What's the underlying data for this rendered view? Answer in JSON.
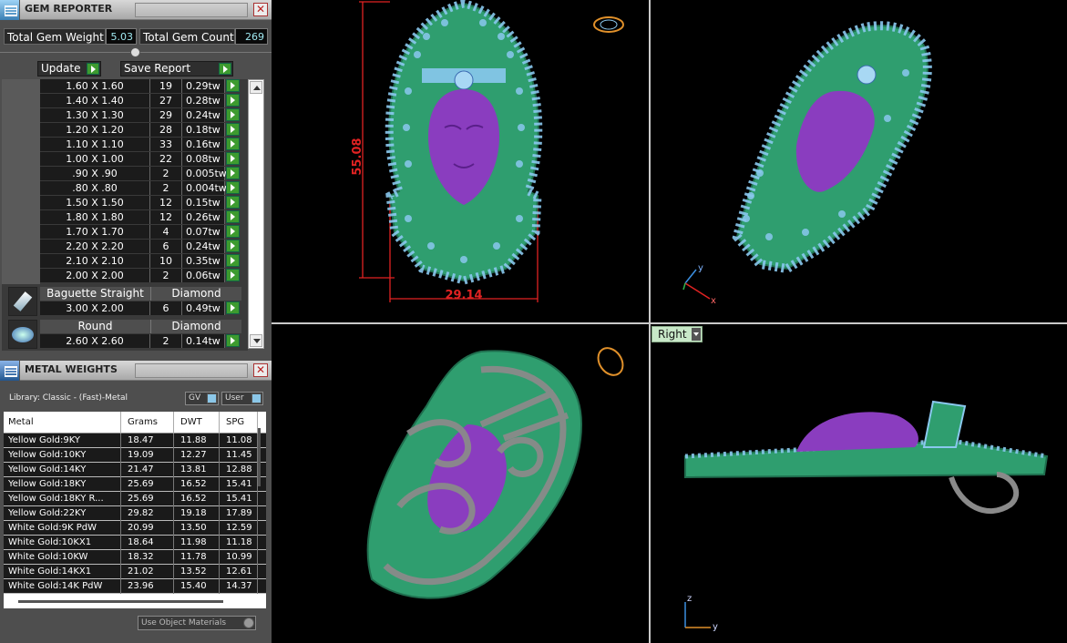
{
  "gem_reporter": {
    "title": "GEM REPORTER",
    "total_weight_label": "Total Gem Weight",
    "total_weight_value": "5.03",
    "total_count_label": "Total Gem Count",
    "total_count_value": "269",
    "update_label": "Update",
    "save_report_label": "Save Report",
    "rows": [
      {
        "size": "1.60 X 1.60",
        "count": "19",
        "tw": "0.29tw"
      },
      {
        "size": "1.40 X 1.40",
        "count": "27",
        "tw": "0.28tw"
      },
      {
        "size": "1.30 X 1.30",
        "count": "29",
        "tw": "0.24tw"
      },
      {
        "size": "1.20 X 1.20",
        "count": "28",
        "tw": "0.18tw"
      },
      {
        "size": "1.10 X 1.10",
        "count": "33",
        "tw": "0.16tw"
      },
      {
        "size": "1.00 X 1.00",
        "count": "22",
        "tw": "0.08tw"
      },
      {
        "size": ".90 X .90",
        "count": "2",
        "tw": "0.005tw"
      },
      {
        "size": ".80 X .80",
        "count": "2",
        "tw": "0.004tw"
      },
      {
        "size": "1.50 X 1.50",
        "count": "12",
        "tw": "0.15tw"
      },
      {
        "size": "1.80 X 1.80",
        "count": "12",
        "tw": "0.26tw"
      },
      {
        "size": "1.70 X 1.70",
        "count": "4",
        "tw": "0.07tw"
      },
      {
        "size": "2.20 X 2.20",
        "count": "6",
        "tw": "0.24tw"
      },
      {
        "size": "2.10 X 2.10",
        "count": "10",
        "tw": "0.35tw"
      },
      {
        "size": "2.00 X 2.00",
        "count": "2",
        "tw": "0.06tw"
      }
    ],
    "groups": [
      {
        "shape": "Baguette Straight",
        "material": "Diamond",
        "icon": "baguette-gem-icon",
        "row": {
          "size": "3.00 X 2.00",
          "count": "6",
          "tw": "0.49tw"
        }
      },
      {
        "shape": "Round",
        "material": "Diamond",
        "icon": "round-gem-icon",
        "row": {
          "size": "2.60 X 2.60",
          "count": "2",
          "tw": "0.14tw"
        }
      }
    ]
  },
  "metal_weights": {
    "title": "METAL WEIGHTS",
    "library": "Library: Classic - (Fast)-Metal",
    "gv_label": "GV",
    "user_label": "User",
    "columns": [
      "Metal",
      "Grams",
      "DWT",
      "SPG"
    ],
    "rows": [
      {
        "metal": "Yellow Gold:9KY",
        "grams": "18.47",
        "dwt": "11.88",
        "spg": "11.08"
      },
      {
        "metal": "Yellow Gold:10KY",
        "grams": "19.09",
        "dwt": "12.27",
        "spg": "11.45"
      },
      {
        "metal": "Yellow Gold:14KY",
        "grams": "21.47",
        "dwt": "13.81",
        "spg": "12.88"
      },
      {
        "metal": "Yellow Gold:18KY",
        "grams": "25.69",
        "dwt": "16.52",
        "spg": "15.41"
      },
      {
        "metal": "Yellow Gold:18KY R...",
        "grams": "25.69",
        "dwt": "16.52",
        "spg": "15.41"
      },
      {
        "metal": "Yellow Gold:22KY",
        "grams": "29.82",
        "dwt": "19.18",
        "spg": "17.89"
      },
      {
        "metal": "White Gold:9K PdW",
        "grams": "20.99",
        "dwt": "13.50",
        "spg": "12.59"
      },
      {
        "metal": "White Gold:10KX1",
        "grams": "18.64",
        "dwt": "11.98",
        "spg": "11.18"
      },
      {
        "metal": "White Gold:10KW",
        "grams": "18.32",
        "dwt": "11.78",
        "spg": "10.99"
      },
      {
        "metal": "White Gold:14KX1",
        "grams": "21.02",
        "dwt": "13.52",
        "spg": "12.61"
      },
      {
        "metal": "White Gold:14K PdW",
        "grams": "23.96",
        "dwt": "15.40",
        "spg": "14.37"
      }
    ],
    "use_object_materials": "Use Object Materials"
  },
  "viewports": {
    "front": {
      "height_dim": "55.08",
      "width_dim": "29.14"
    },
    "right": {
      "label": "Right",
      "axis_up": "z",
      "axis_right": "y"
    },
    "perspective": {
      "axis_up": "y",
      "axis_right": "x"
    }
  },
  "colors": {
    "metal_green": "#2f9e6f",
    "gem_blue": "#8ac8ee",
    "face_purple": "#8a3dbf",
    "dimension_red": "#e12222",
    "shank_gray": "#8a8a8a"
  }
}
